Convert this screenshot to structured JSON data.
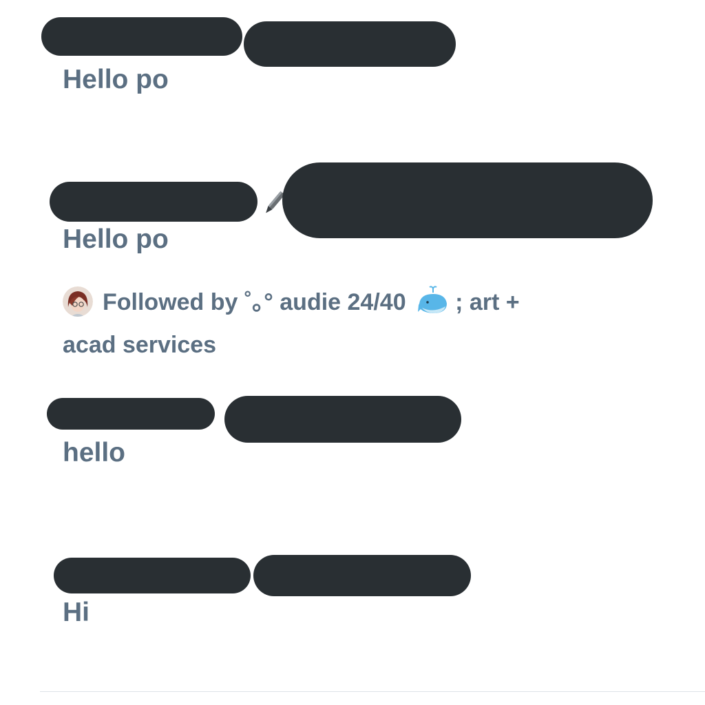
{
  "messages": [
    {
      "text": "Hello po"
    },
    {
      "text": "Hello po"
    },
    {
      "text": "hello"
    },
    {
      "text": "Hi"
    }
  ],
  "followed_by": {
    "prefix": "Followed by",
    "name": "˚｡° audie 24/40",
    "suffix": "; art +",
    "second_line": "acad services",
    "avatar_icon": "user-avatar-icon",
    "emoji_icon": "spouting-whale-icon"
  },
  "colors": {
    "text": "#5b6f82",
    "redaction": "#292f33",
    "divider": "#dde3e8",
    "whale": "#58b6e8"
  }
}
